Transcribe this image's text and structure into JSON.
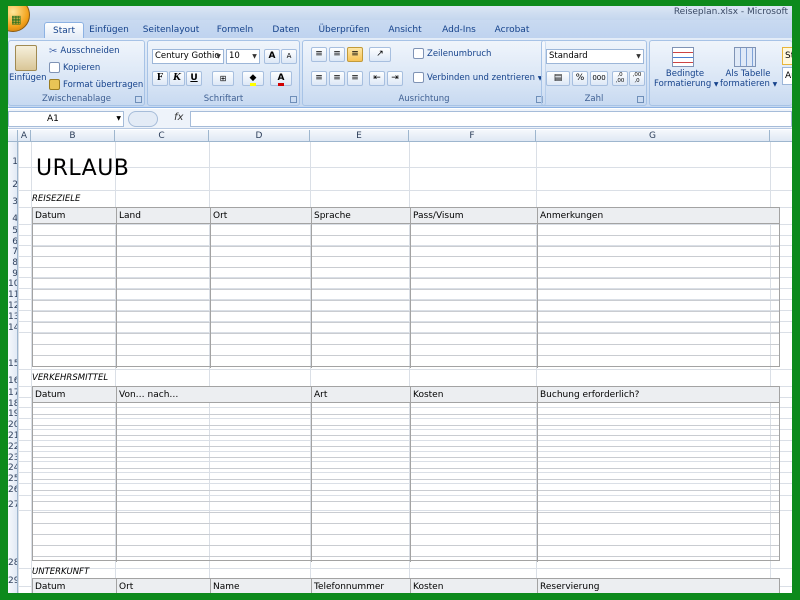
{
  "window": {
    "title": "Reiseplan.xlsx - Microsoft"
  },
  "tabs": [
    "Start",
    "Einfügen",
    "Seitenlayout",
    "Formeln",
    "Daten",
    "Überprüfen",
    "Ansicht",
    "Add-Ins",
    "Acrobat"
  ],
  "active_tab": "Start",
  "ribbon": {
    "clipboard": {
      "label": "Zwischenablage",
      "paste": "Einfügen",
      "cut": "Ausschneiden",
      "copy": "Kopieren",
      "format_painter": "Format übertragen"
    },
    "font": {
      "label": "Schriftart",
      "font_name": "Century Gothic",
      "font_size": "10",
      "bold": "F",
      "italic": "K",
      "underline": "U",
      "grow": "A",
      "shrink": "A",
      "color_letter": "A"
    },
    "alignment": {
      "label": "Ausrichtung",
      "wrap": "Zeilenumbruch",
      "merge": "Verbinden und zentrieren"
    },
    "number": {
      "label": "Zahl",
      "format": "Standard",
      "percent": "%",
      "thousands": "000",
      "inc_dec": ",0 ,00",
      "dec_dec": ",00 ,0"
    },
    "styles": {
      "conditional_1": "Bedingte",
      "conditional_2": "Formatierung",
      "as_table_1": "Als Tabelle",
      "as_table_2": "formatieren",
      "style_preview_1": "St",
      "style_preview_2": "Au"
    }
  },
  "formula_bar": {
    "name_box": "A1",
    "fx": "fx",
    "content": ""
  },
  "columns": [
    "A",
    "B",
    "C",
    "D",
    "E",
    "F",
    "G"
  ],
  "rows": [
    "1",
    "2",
    "3",
    "4",
    "5",
    "6",
    "7",
    "8",
    "9",
    "10",
    "11",
    "12",
    "13",
    "14",
    "15",
    "16",
    "17",
    "18",
    "19",
    "20",
    "21",
    "22",
    "23",
    "24",
    "25",
    "26",
    "27",
    "28",
    "29"
  ],
  "sheet": {
    "title": "URLAUB",
    "sections": [
      {
        "label": "REISEZIELE",
        "headers": [
          "Datum",
          "Land",
          "Ort",
          "Sprache",
          "Pass/Visum",
          "Anmerkungen"
        ]
      },
      {
        "label": "VERKEHRSMITTEL",
        "headers": [
          "Datum",
          "Von… nach…",
          "Art",
          "Kosten",
          "Buchung erforderlich?"
        ]
      },
      {
        "label": "UNTERKUNFT",
        "headers": [
          "Datum",
          "Ort",
          "Name",
          "Telefonnummer",
          "Kosten",
          "Reservierung"
        ]
      }
    ]
  }
}
